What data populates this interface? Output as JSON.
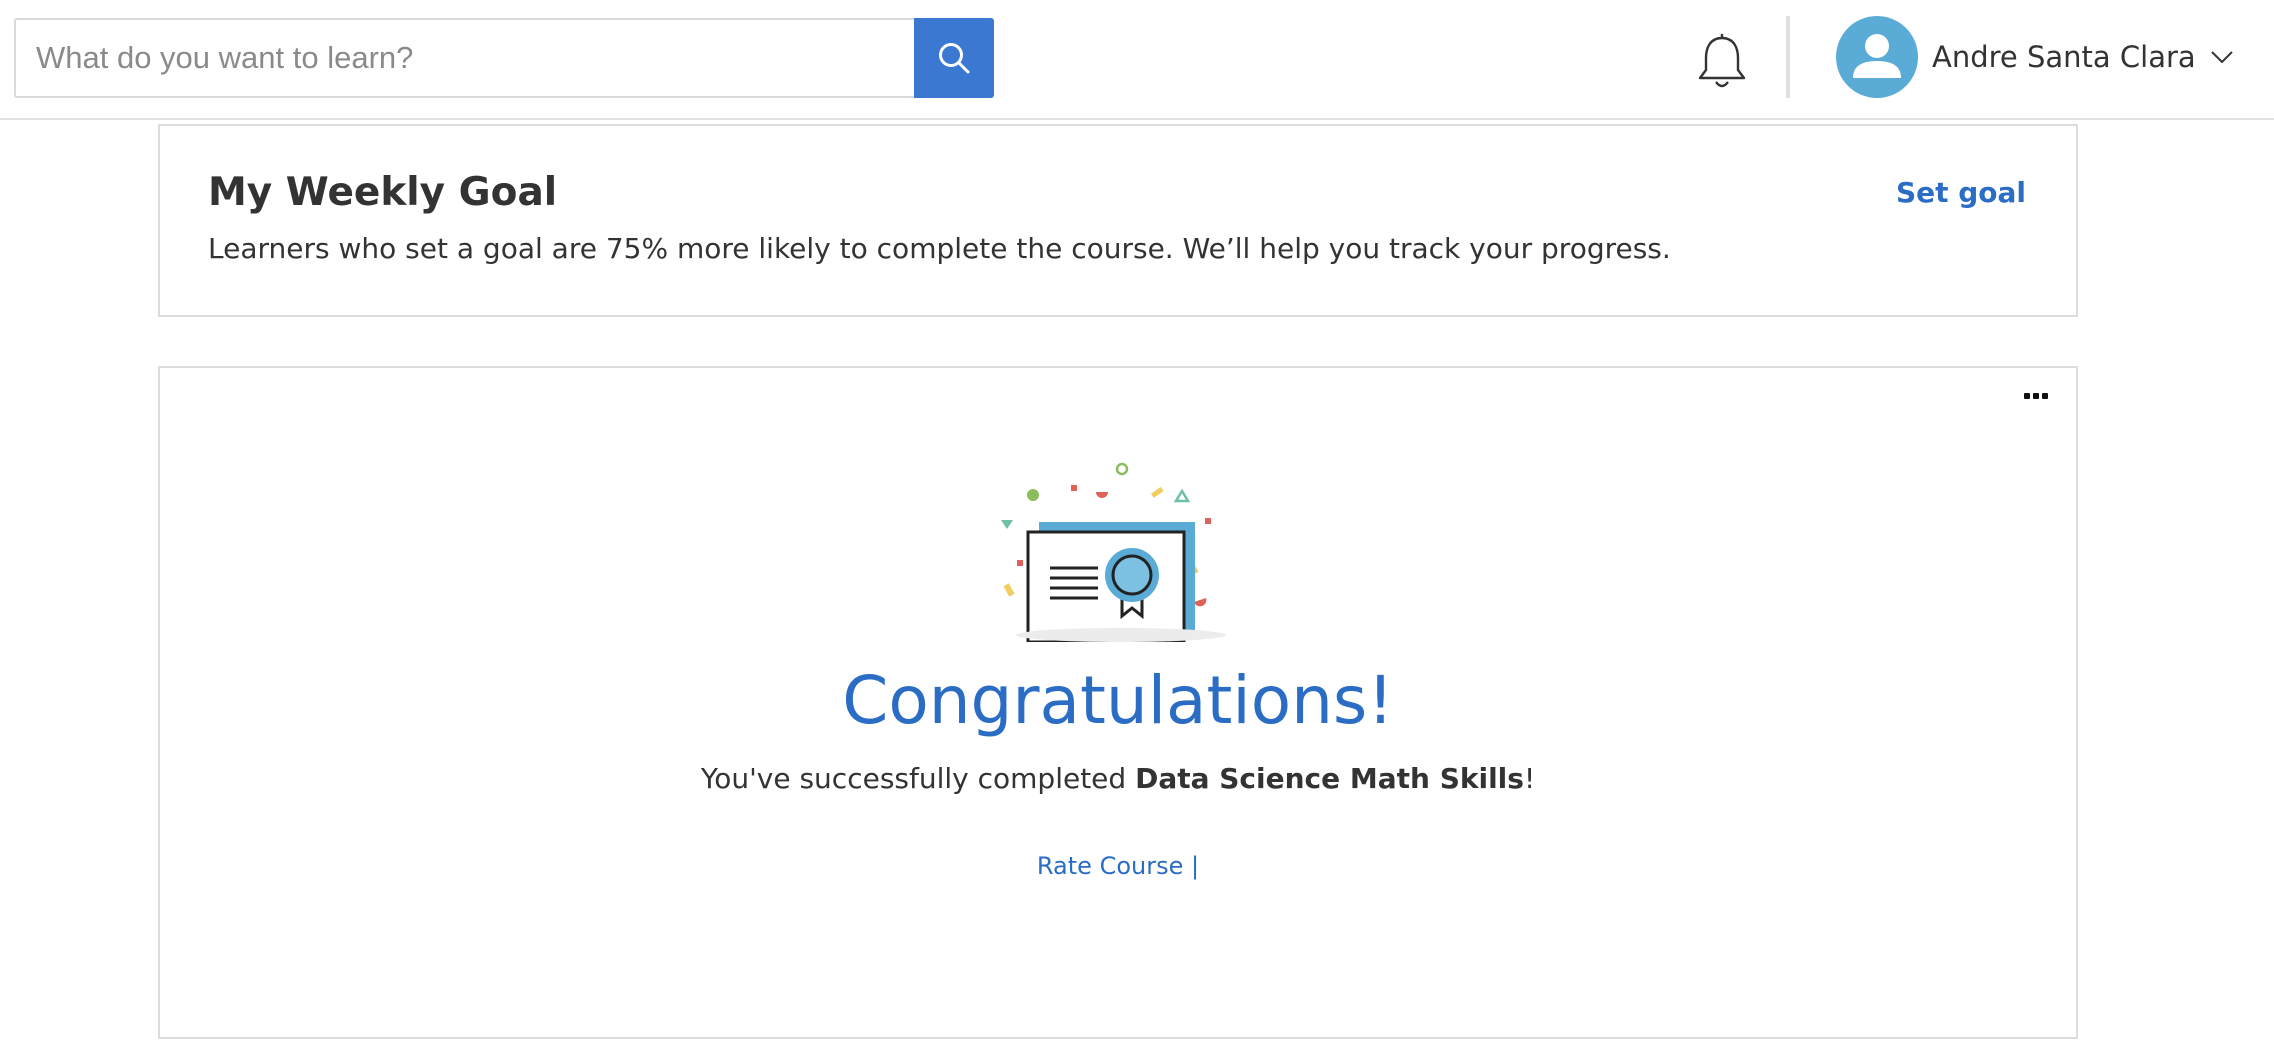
{
  "header": {
    "search": {
      "placeholder": "What do you want to learn?",
      "value": ""
    },
    "icons": {
      "search": "search-icon",
      "notifications": "bell-icon",
      "avatar": "user-icon",
      "menu": "chevron-down-icon"
    },
    "user": {
      "name": "Andre Santa Clara"
    }
  },
  "weekly_goal": {
    "title": "My Weekly Goal",
    "description": "Learners who set a goal are 75% more likely to complete the course. We’ll help you track your progress.",
    "set_goal_label": "Set goal"
  },
  "completion": {
    "illustration": "certificate-icon",
    "heading": "Congratulations!",
    "message_prefix": "You've successfully completed ",
    "course_name": "Data Science Math Skills",
    "message_suffix": "!",
    "rate_label": "Rate Course",
    "rate_separator": " |",
    "more_icon": "more-horizontal-icon"
  },
  "colors": {
    "accent": "#2b6cc4",
    "search_button": "#3a78d2",
    "avatar_bg": "#5aacd6",
    "border": "#dcdcdc"
  }
}
